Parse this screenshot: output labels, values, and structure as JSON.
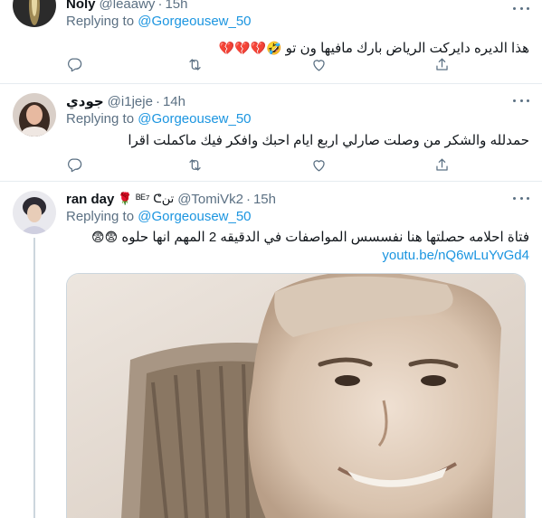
{
  "tweets": [
    {
      "name": "Noly",
      "handle": "@leaawy",
      "time": "15h",
      "reply_prefix": "Replying to",
      "reply_to": "@Gorgeousew_50",
      "text": "هذا الديره دايركت الرياض بارك مافيها ون تو",
      "emoji": "🤣💔💔💔"
    },
    {
      "name": "جودي",
      "handle": "@i1jeje",
      "time": "14h",
      "reply_prefix": "Replying to",
      "reply_to": "@Gorgeousew_50",
      "text": "حمدلله والشكر من وصلت صارلي اربع ايام احبك وافكر فيك ماكملت اقرا",
      "emoji": ""
    },
    {
      "name": "ran day",
      "name_badge": "🌹 ᴮᴱ⁷ ᕦتن",
      "handle": "@TomiVk2",
      "time": "15h",
      "reply_prefix": "Replying to",
      "reply_to": "@Gorgeousew_50",
      "text": "فتاة احلامه حصلتها هنا نفسسس المواصفات في الدقيقه 2 المهم انها حلوه",
      "emoji": "😨😨",
      "link": "youtu.be/nQ6wLuYvGd4"
    }
  ],
  "dot_separator": "·",
  "icons": {
    "reply": "reply-icon",
    "retweet": "retweet-icon",
    "like": "heart-icon",
    "share": "share-icon",
    "more": "more-icon"
  },
  "colors": {
    "link": "#1b95e0",
    "secondary_text": "#5b7083",
    "divider": "#e6ecf0"
  }
}
